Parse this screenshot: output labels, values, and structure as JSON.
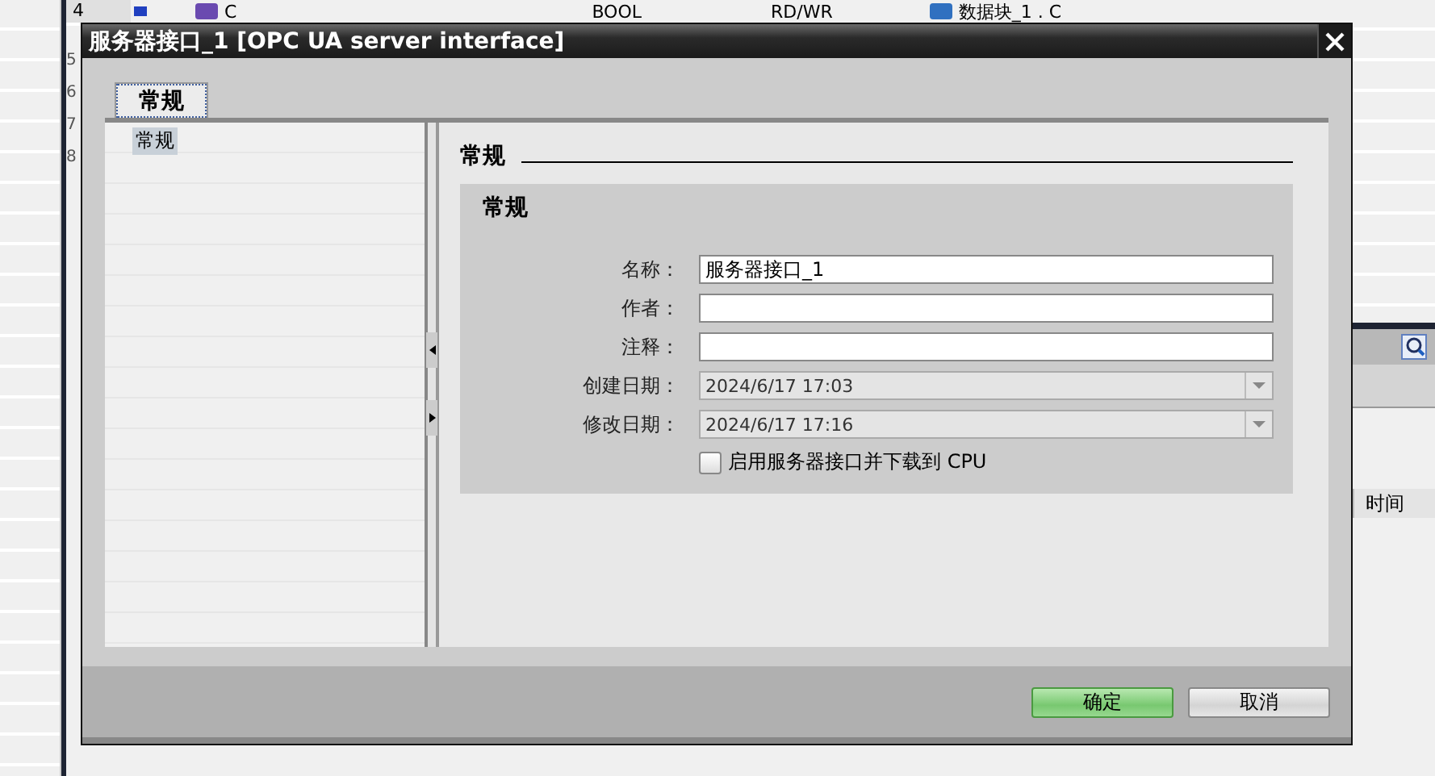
{
  "background": {
    "top_row": {
      "number": "4",
      "name": "C",
      "type": "BOOL",
      "access": "RD/WR",
      "source": "数据块_1 . C"
    },
    "row_numbers": [
      "5",
      "6",
      "7",
      "8"
    ],
    "column_header": "时间"
  },
  "dialog": {
    "title": "服务器接口_1 [OPC UA server interface]",
    "tabs": [
      {
        "label": "常规",
        "selected": true
      }
    ],
    "tree": [
      {
        "label": "常规",
        "selected": true
      }
    ],
    "section_title": "常规",
    "group": {
      "title": "常规",
      "fields": [
        {
          "kind": "text",
          "label": "名称：",
          "value": "服务器接口_1"
        },
        {
          "kind": "text",
          "label": "作者："
        },
        {
          "kind": "text",
          "label": "注释："
        },
        {
          "kind": "dropdown",
          "label": "创建日期：",
          "value": "2024/6/17 17:03"
        },
        {
          "kind": "dropdown",
          "label": "修改日期：",
          "value": "2024/6/17 17:16"
        }
      ],
      "checkbox": {
        "label": "启用服务器接口并下载到 CPU",
        "checked": false
      }
    },
    "buttons": [
      {
        "label": "确定",
        "kind": "primary"
      },
      {
        "label": "取消",
        "kind": "secondary"
      }
    ]
  }
}
